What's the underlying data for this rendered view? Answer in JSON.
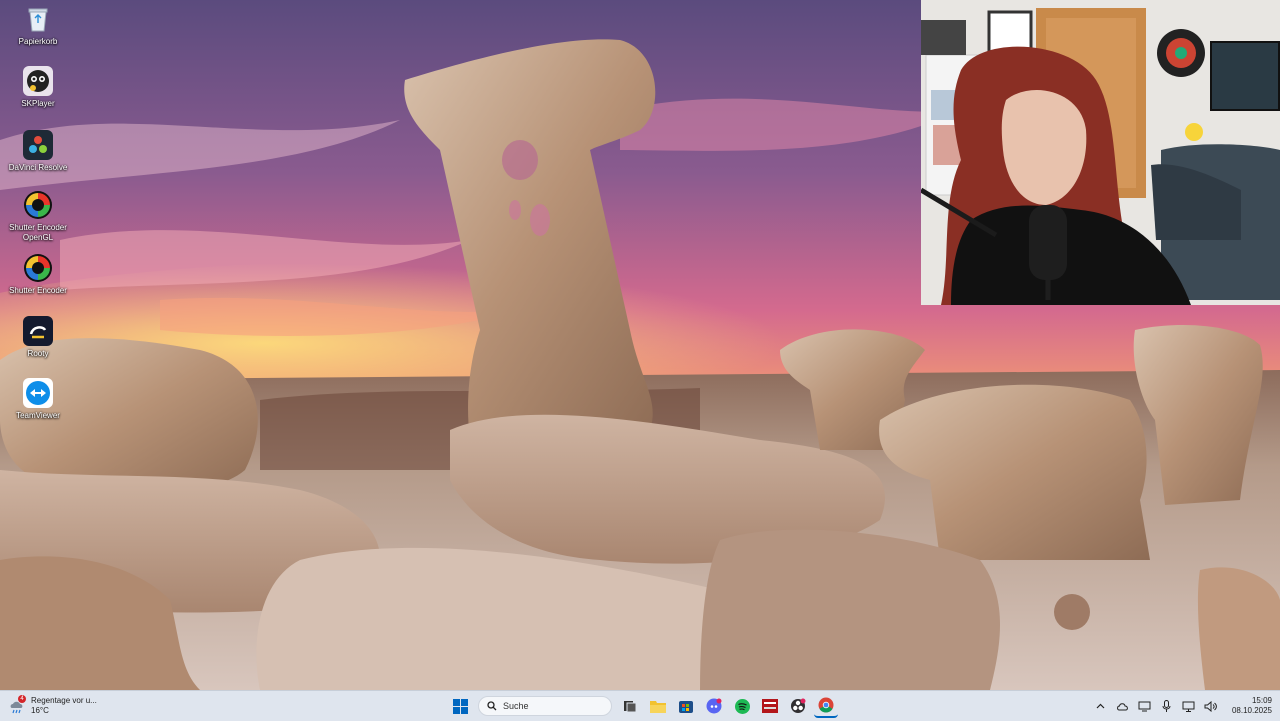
{
  "desktop": {
    "icons": [
      {
        "label": "Papierkorb",
        "icon": "recycle-bin-icon"
      },
      {
        "label": "SKPlayer",
        "icon": "skplayer-icon"
      },
      {
        "label": "DaVinci Resolve",
        "icon": "davinci-resolve-icon"
      },
      {
        "label": "Shutter Encoder OpenGL",
        "icon": "shutter-encoder-icon"
      },
      {
        "label": "Shutter Encoder",
        "icon": "shutter-encoder-icon"
      },
      {
        "label": "Rooty",
        "icon": "rooty-icon"
      },
      {
        "label": "TeamViewer",
        "icon": "teamviewer-icon"
      }
    ]
  },
  "webcam": {
    "description_icon": "webcam-feed"
  },
  "taskbar": {
    "weather": {
      "text": "Regentage vor u...",
      "temp": "16°C",
      "badge": "4"
    },
    "search": {
      "placeholder": "Suche"
    },
    "apps": [
      "start-icon",
      "task-view-icon",
      "file-explorer-icon",
      "store-icon",
      "discord-icon",
      "spotify-icon",
      "voicemeeter-icon",
      "obs-icon",
      "chrome-icon"
    ],
    "clock": {
      "time": "15:09",
      "date": "08.10.2025"
    }
  },
  "colors": {
    "taskbar_bg": "#dfe5ee",
    "accent": "#0067c0"
  }
}
